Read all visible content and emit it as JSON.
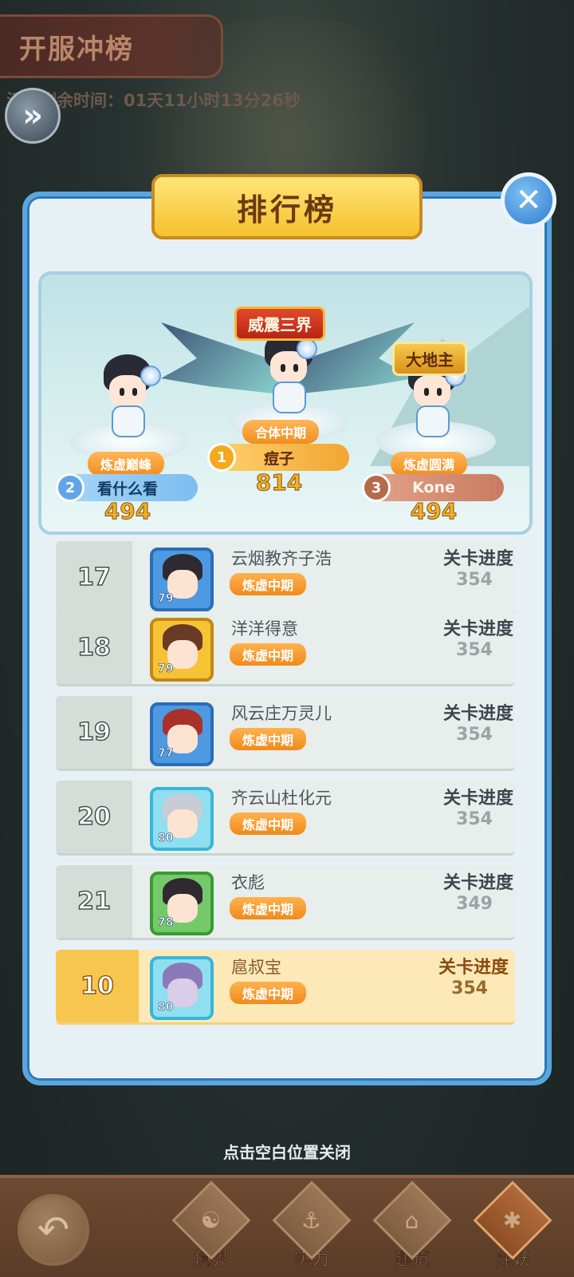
{
  "event": {
    "title": "开服冲榜",
    "countdown": "活动剩余时间：01天11小时13分26秒"
  },
  "panel": {
    "title": "排行榜",
    "close_icon": "close-icon"
  },
  "podium": [
    {
      "rank": "1",
      "name": "痘子",
      "score": "814",
      "realm": "合体中期",
      "title_badge": "威震三界"
    },
    {
      "rank": "2",
      "name": "看什么看",
      "score": "494",
      "realm": "炼虚巅峰"
    },
    {
      "rank": "3",
      "name": "Kone",
      "score": "494",
      "realm": "炼虚圆满",
      "title_badge": "大地主"
    }
  ],
  "list": {
    "rows": [
      {
        "rank": "17",
        "name": "云烟教齐子浩",
        "realm": "炼虚中期",
        "level": "79",
        "progress_label": "关卡进度",
        "progress": "354",
        "frame": "blue"
      },
      {
        "rank": "18",
        "name": "洋洋得意",
        "realm": "炼虚中期",
        "level": "79",
        "progress_label": "关卡进度",
        "progress": "354",
        "frame": "gold"
      },
      {
        "rank": "19",
        "name": "风云庄万灵儿",
        "realm": "炼虚中期",
        "level": "77",
        "progress_label": "关卡进度",
        "progress": "354",
        "frame": "blue"
      },
      {
        "rank": "20",
        "name": "齐云山杜化元",
        "realm": "炼虚中期",
        "level": "80",
        "progress_label": "关卡进度",
        "progress": "354",
        "frame": "cyan"
      },
      {
        "rank": "21",
        "name": "衣彪",
        "realm": "炼虚中期",
        "level": "78",
        "progress_label": "关卡进度",
        "progress": "349",
        "frame": "green"
      }
    ],
    "mine": {
      "rank": "10",
      "name": "扈叔宝",
      "realm": "炼虚中期",
      "level": "80",
      "progress_label": "关卡进度",
      "progress": "354",
      "frame": "cyan"
    }
  },
  "tap_hint": "点击空白位置关闭",
  "nav": {
    "back_icon": "back-arrow-icon",
    "items": [
      {
        "label": "境界",
        "icon": "yin-yang-icon"
      },
      {
        "label": "实力",
        "icon": "anchor-icon"
      },
      {
        "label": "建筑",
        "icon": "pagoda-icon"
      },
      {
        "label": "除妖",
        "icon": "paw-icon"
      }
    ]
  },
  "colors": {
    "panel_border": "#5aa6df",
    "highlight_row": "#fde9b8",
    "realm_tag": "#f18a1c",
    "gold_score": "#f2b025"
  }
}
